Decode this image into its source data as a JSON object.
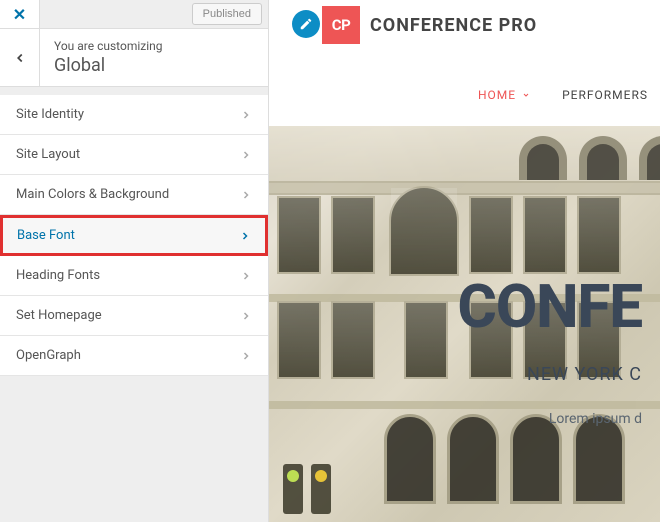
{
  "topbar": {
    "publish_label": "Published"
  },
  "breadcrumb": {
    "label": "You are customizing",
    "title": "Global"
  },
  "menu": {
    "items": [
      {
        "label": "Site Identity"
      },
      {
        "label": "Site Layout"
      },
      {
        "label": "Main Colors & Background"
      },
      {
        "label": "Base Font"
      },
      {
        "label": "Heading Fonts"
      },
      {
        "label": "Set Homepage"
      },
      {
        "label": "OpenGraph"
      }
    ]
  },
  "preview": {
    "logo_initials": "CP",
    "logo_text": "CONFERENCE PRO",
    "nav": {
      "home": "HOME",
      "performers": "PERFORMERS"
    },
    "hero": {
      "title": "CONFE",
      "subtitle": "NEW YORK C",
      "desc": "Lorem ipsum d"
    }
  }
}
